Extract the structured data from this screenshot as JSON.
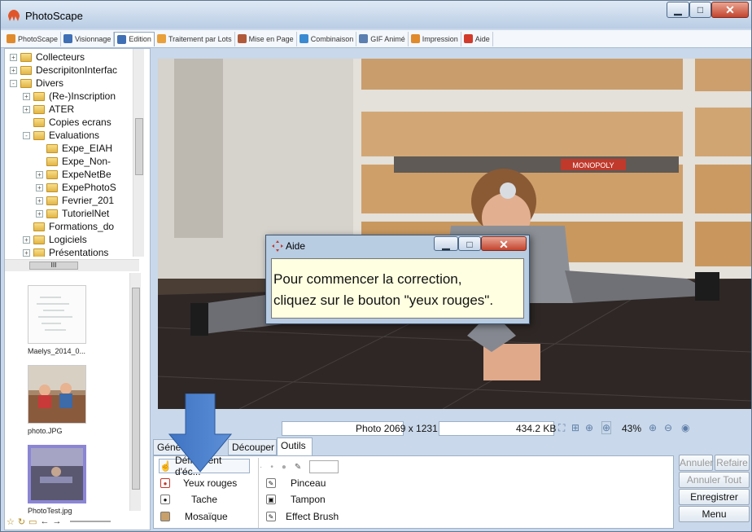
{
  "window": {
    "title": "PhotoScape"
  },
  "menu": [
    {
      "label": "PhotoScape",
      "color": "#e08a2c"
    },
    {
      "label": "Visionnage",
      "color": "#3f6fb5"
    },
    {
      "label": "Edition",
      "color": "#3f6fb5",
      "active": true
    },
    {
      "label": "Traitement par Lots",
      "color": "#e9a03a"
    },
    {
      "label": "Mise en Page",
      "color": "#b05a3a"
    },
    {
      "label": "Combinaison",
      "color": "#3a8ad2"
    },
    {
      "label": "GIF Animé",
      "color": "#5a7fb0"
    },
    {
      "label": "Impression",
      "color": "#e08a2c"
    },
    {
      "label": "Aide",
      "color": "#d23b2b"
    }
  ],
  "tree": {
    "items": [
      {
        "label": "Collecteurs",
        "expander": "+",
        "level": 1
      },
      {
        "label": "DescripitonInterfac",
        "expander": "+",
        "level": 1
      },
      {
        "label": "Divers",
        "expander": "-",
        "level": 1
      },
      {
        "label": "(Re-)Inscription",
        "expander": "+",
        "level": 2
      },
      {
        "label": "ATER",
        "expander": "+",
        "level": 2
      },
      {
        "label": "Copies ecrans",
        "expander": "",
        "level": 2
      },
      {
        "label": "Evaluations",
        "expander": "-",
        "level": 2
      },
      {
        "label": "Expe_EIAH",
        "expander": "",
        "level": 3
      },
      {
        "label": "Expe_Non-",
        "expander": "",
        "level": 3
      },
      {
        "label": "ExpeNetBe",
        "expander": "+",
        "level": 3
      },
      {
        "label": "ExpePhotoS",
        "expander": "+",
        "level": 3
      },
      {
        "label": "Fevrier_201",
        "expander": "+",
        "level": 3
      },
      {
        "label": "TutorielNet",
        "expander": "+",
        "level": 3
      },
      {
        "label": "Formations_do",
        "expander": "",
        "level": 2
      },
      {
        "label": "Logiciels",
        "expander": "+",
        "level": 2
      },
      {
        "label": "Présentations",
        "expander": "+",
        "level": 2
      }
    ],
    "hscroll_label": "III"
  },
  "thumbnails": [
    {
      "label": "Maelys_2014_0..."
    },
    {
      "label": "photo.JPG"
    },
    {
      "label": "PhotoTest.jpg"
    }
  ],
  "status": {
    "dimensions": "Photo 2069 x 1231",
    "size": "434.2 KB",
    "zoom": "43%"
  },
  "tabs": [
    {
      "label": "Géné"
    },
    {
      "label": "Découper"
    },
    {
      "label": "Outils",
      "active": true
    }
  ],
  "tools": {
    "scroll": "Défilement d'éc...",
    "left": [
      "Yeux rouges",
      "Tache",
      "Mosaïque"
    ],
    "right": [
      "Pinceau",
      "Tampon",
      "Effect Brush"
    ]
  },
  "actions": {
    "undo": "Annuler",
    "redo": "Refaire",
    "undo_all": "Annuler Tout",
    "save": "Enregistrer",
    "menu": "Menu"
  },
  "dialog": {
    "title": "Aide",
    "line1": "Pour commencer la correction,",
    "line2": "cliquez sur le bouton \"yeux rouges\"."
  },
  "photo_text": {
    "monopoly": "MONOPOLY"
  }
}
